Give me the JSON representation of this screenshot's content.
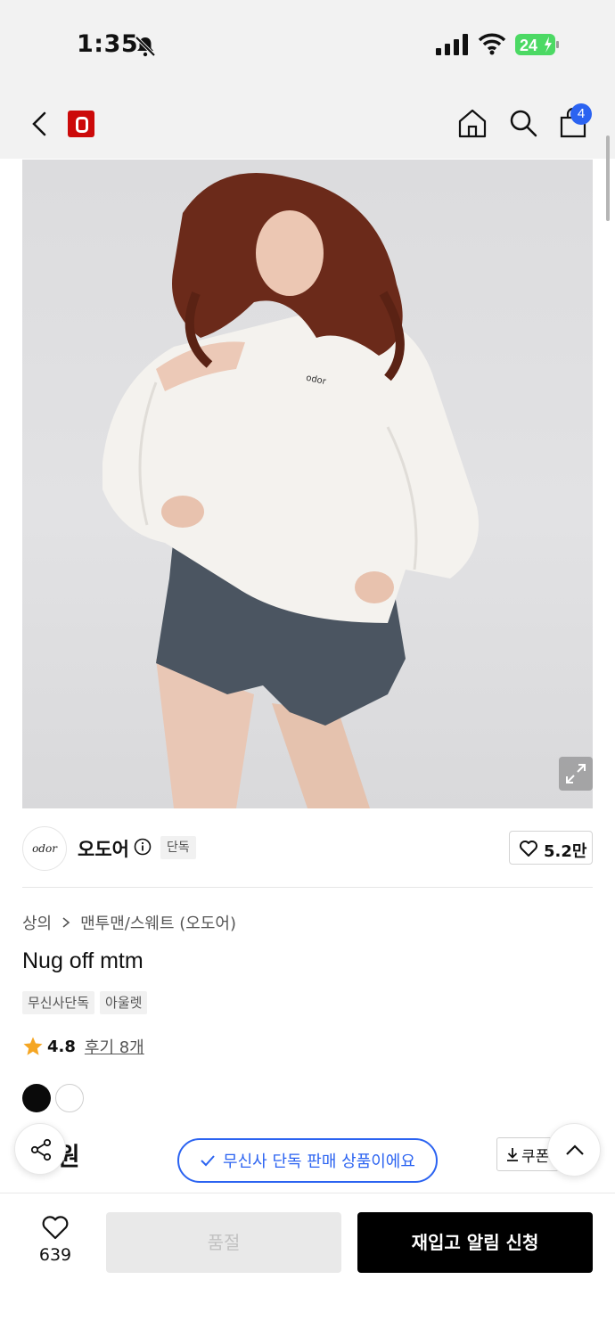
{
  "status_bar": {
    "time": "1:35",
    "battery": "24"
  },
  "nav": {
    "cart_count": "4"
  },
  "brand": {
    "logo_text": "odor",
    "name": "오도어",
    "exclusive_tag": "단독",
    "likes": "5.2만"
  },
  "breadcrumb": {
    "category": "상의",
    "subcategory": "맨투맨/스웨트 (오도어)"
  },
  "product": {
    "title": "Nug off mtm",
    "tags": [
      "무신사단독",
      "아울렛"
    ],
    "rating": "4.8",
    "reviews": "후기 8개",
    "price_partial": "00원",
    "swatches": [
      "#0a0a0a",
      "#ffffff"
    ]
  },
  "toast": {
    "text": "무신사 단독 판매 상품이에요"
  },
  "coupon": {
    "label": "쿠폰"
  },
  "bottom": {
    "wish_count": "639",
    "soldout_label": "품절",
    "restock_label": "재입고 알림 신청"
  },
  "colors": {
    "accent_blue": "#2b63f1",
    "brand_red": "#cc0a0a",
    "star": "#f5a623"
  },
  "icons": [
    "bell-muted-icon",
    "signal-icon",
    "wifi-icon",
    "battery-icon",
    "back-icon",
    "musinsa-logo",
    "home-icon",
    "search-icon",
    "bag-icon",
    "expand-icon",
    "info-icon",
    "heart-icon",
    "chevron-right-icon",
    "star-icon",
    "share-icon",
    "check-icon",
    "download-icon",
    "arrow-up-icon"
  ]
}
